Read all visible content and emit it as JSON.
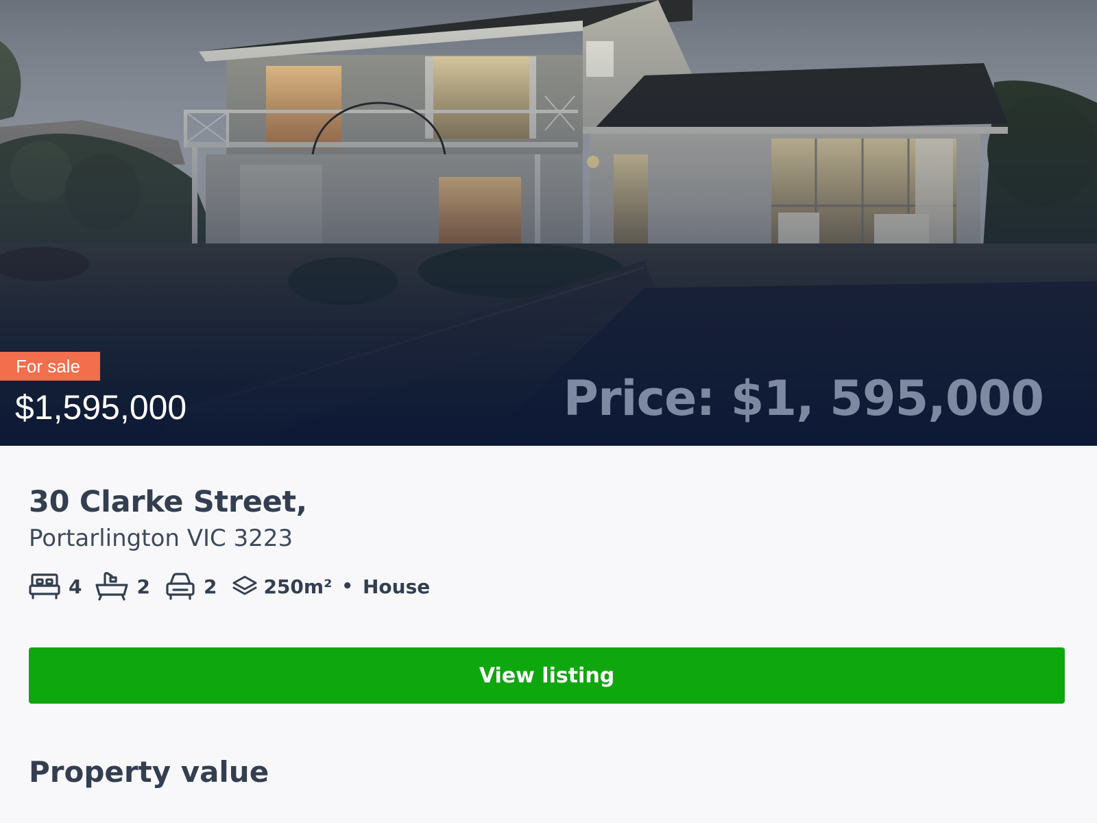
{
  "listing": {
    "status_badge": "For sale",
    "price": "$1,595,000",
    "photo_overlay_text": "Price: $1, 595,000",
    "address_line1": "30 Clarke Street,",
    "address_line2": "Portarlington VIC 3223",
    "features": {
      "bedrooms": "4",
      "bathrooms": "2",
      "car_spaces": "2",
      "land_size": "250m²",
      "separator": "•",
      "property_type": "House"
    },
    "icons": {
      "bedrooms": "bed-icon",
      "bathrooms": "bathtub-icon",
      "car_spaces": "car-icon",
      "land_size": "layers-icon"
    }
  },
  "actions": {
    "view_listing_label": "View listing"
  },
  "sections": {
    "property_value_heading": "Property value"
  },
  "colors": {
    "badge": "#f26e4c",
    "button": "#0ea80e",
    "text_primary": "#333f50",
    "page_background": "#f8f8fb"
  }
}
